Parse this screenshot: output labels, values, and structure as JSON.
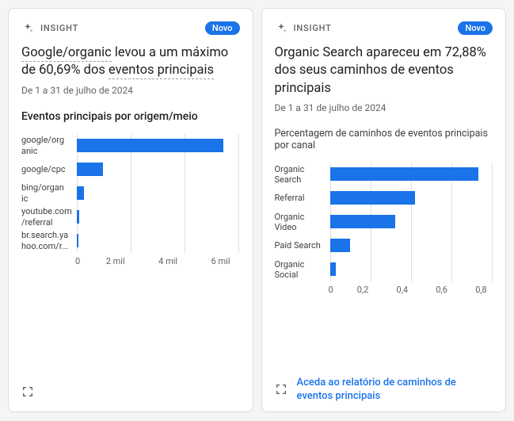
{
  "cards": [
    {
      "insight_label": "INSIGHT",
      "badge": "Novo",
      "title_pre": "Google/organic",
      "title_mid": " levou a um máximo de 60,69% dos ",
      "title_ul": "eventos principais",
      "date_range": "De 1 a 31 de julho de 2024",
      "subtitle": "Eventos principais por origem/meio",
      "footer_link": "",
      "chart_data": {
        "type": "bar",
        "orientation": "horizontal",
        "title": "Eventos principais por origem/meio",
        "xlabel": "",
        "ylabel": "",
        "xlim": [
          0,
          6000
        ],
        "categories": [
          "google/organic",
          "google/cpc",
          "bing/organic",
          "youtube.com/referral",
          "br.search.yahoo.com/r..."
        ],
        "values": [
          5400,
          950,
          250,
          80,
          60
        ],
        "x_ticks": [
          0,
          2000,
          4000,
          6000
        ],
        "x_tick_labels": [
          "0",
          "2 mil",
          "4 mil",
          "6 mil"
        ]
      }
    },
    {
      "insight_label": "INSIGHT",
      "badge": "Novo",
      "title_plain": "Organic Search apareceu em 72,88% dos seus caminhos de eventos principais",
      "date_range": "De 1 a 31 de julho de 2024",
      "subtitle": "Percentagem de caminhos de eventos principais por canal",
      "footer_link": "Aceda ao relatório de caminhos de eventos principais",
      "chart_data": {
        "type": "bar",
        "orientation": "horizontal",
        "title": "Percentagem de caminhos de eventos principais por canal",
        "xlabel": "",
        "ylabel": "",
        "xlim": [
          0,
          0.8
        ],
        "categories": [
          "Organic Search",
          "Referral",
          "Organic Video",
          "Paid Search",
          "Organic Social"
        ],
        "values": [
          0.73,
          0.42,
          0.32,
          0.1,
          0.03
        ],
        "x_ticks": [
          0,
          0.2,
          0.4,
          0.6,
          0.8
        ],
        "x_tick_labels": [
          "0",
          "0,2",
          "0,4",
          "0,6",
          "0,8"
        ]
      }
    }
  ]
}
